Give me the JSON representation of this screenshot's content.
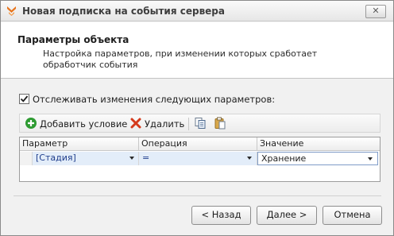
{
  "window": {
    "title": "Новая подписка на события сервера",
    "close_glyph": "✕"
  },
  "header": {
    "title": "Параметры объекта",
    "description": "Настройка параметров, при изменении которых сработает обработчик события"
  },
  "tracking": {
    "checked": true,
    "label": "Отслеживать изменения следующих параметров:"
  },
  "toolbar": {
    "add_label": "Добавить условие",
    "delete_label": "Удалить",
    "add_icon": "add-icon",
    "delete_icon": "delete-icon",
    "copy_icon": "copy-icon",
    "paste_icon": "paste-icon"
  },
  "grid": {
    "columns": [
      "Параметр",
      "Операция",
      "Значение"
    ],
    "rows": [
      {
        "parameter": "[Стадия]",
        "operation": "=",
        "value": "Хранение"
      }
    ]
  },
  "buttons": {
    "back": "< Назад",
    "next": "Далее >",
    "cancel": "Отмена"
  },
  "colors": {
    "accent_orange": "#e8741b",
    "add_green": "#2e9b32",
    "delete_red": "#d43a1c",
    "selection": "#e3edf9"
  }
}
